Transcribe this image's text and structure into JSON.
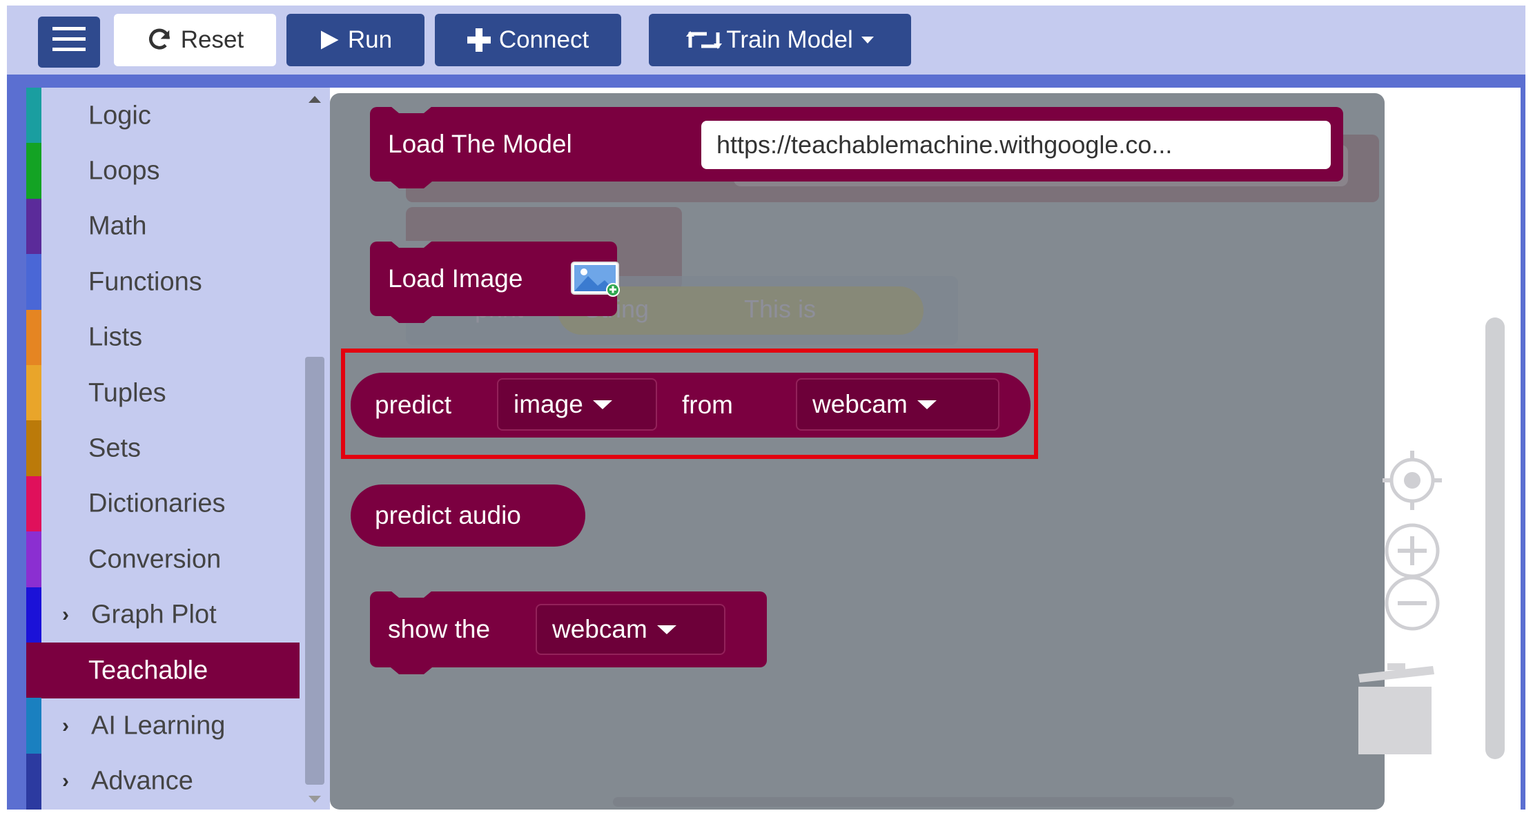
{
  "toolbar": {
    "menu_icon": "hamburger-menu-icon",
    "reset_label": "Reset",
    "reset_icon": "refresh-icon",
    "run_label": "Run",
    "run_icon": "play-icon",
    "connect_label": "Connect",
    "connect_icon": "plus-icon",
    "train_label": "Train Model",
    "train_icon": "retweet-icon"
  },
  "sidebar": {
    "categories": [
      {
        "label": "Logic",
        "color": "#1a9ea0"
      },
      {
        "label": "Loops",
        "color": "#13a324"
      },
      {
        "label": "Math",
        "color": "#5b2b9a"
      },
      {
        "label": "Functions",
        "color": "#4a67d6"
      },
      {
        "label": "Lists",
        "color": "#e58522"
      },
      {
        "label": "Tuples",
        "color": "#e9a52a"
      },
      {
        "label": "Sets",
        "color": "#bb7a09"
      },
      {
        "label": "Dictionaries",
        "color": "#e0105b"
      },
      {
        "label": "Conversion",
        "color": "#8b2fd1"
      },
      {
        "label": "Graph Plot",
        "color": "#1b12d8",
        "expandable": true
      },
      {
        "label": "Teachable",
        "color": "#7b0040",
        "active": true
      },
      {
        "label": "AI Learning",
        "color": "#1a80c0",
        "expandable": true
      },
      {
        "label": "Advance",
        "color": "#2c3aa0",
        "expandable": true
      }
    ]
  },
  "blocks": {
    "load_model_label": "Load The Model",
    "load_model_url": "https://teachablemachine.withgoogle.co...",
    "load_image_label": "Load Image",
    "load_image_icon": "image-add-icon",
    "predict_label": "predict",
    "predict_type": "image",
    "predict_from": "from",
    "predict_source": "webcam",
    "predict_audio_label": "predict audio",
    "show_label": "show the",
    "show_source": "webcam"
  },
  "ghost": {
    "print_label": "print",
    "string_label": "String",
    "string_value": "This is"
  },
  "colors": {
    "toolbar_bg": "#c5cbef",
    "button_bg": "#2f4a8e",
    "block": "#7b0040",
    "flyout_bg": "#838a91",
    "highlight": "#e3000f"
  },
  "controls": {
    "recenter_icon": "recenter-target-icon",
    "zoom_in_icon": "zoom-in-icon",
    "zoom_out_icon": "zoom-out-icon",
    "trash_icon": "trash-icon"
  }
}
